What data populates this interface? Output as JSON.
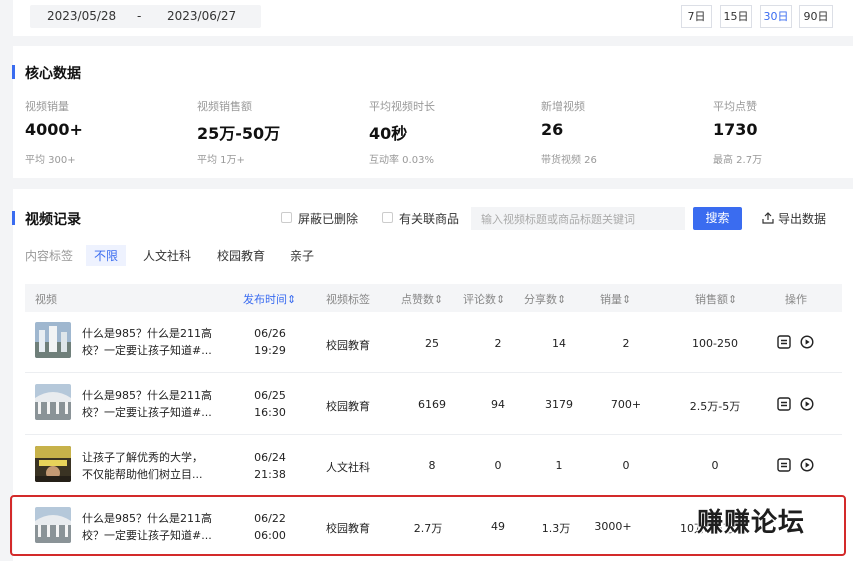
{
  "date_range": {
    "start": "2023/05/28",
    "sep": "-",
    "end": "2023/06/27"
  },
  "range_buttons": [
    "7日",
    "15日",
    "30日",
    "90日"
  ],
  "range_active": "30日",
  "core": {
    "title": "核心数据",
    "metrics": [
      {
        "label": "视频销量",
        "value": "4000+",
        "sub": "平均 300+"
      },
      {
        "label": "视频销售额",
        "value": "25万-50万",
        "sub": "平均 1万+"
      },
      {
        "label": "平均视频时长",
        "value": "40秒",
        "sub": "互动率 0.03%"
      },
      {
        "label": "新增视频",
        "value": "26",
        "sub": "带货视频 26"
      },
      {
        "label": "平均点赞",
        "value": "1730",
        "sub": "最高 2.7万"
      }
    ]
  },
  "records": {
    "title": "视频记录",
    "filter_deleted": "屏蔽已删除",
    "filter_goods": "有关联商品",
    "search_placeholder": "输入视频标题或商品标题关键词",
    "search_label": "搜索",
    "export_label": "导出数据",
    "tag_label": "内容标签",
    "tags": [
      "不限",
      "人文社科",
      "校园教育",
      "亲子"
    ],
    "columns": [
      "视频",
      "发布时间",
      "视频标签",
      "点赞数",
      "评论数",
      "分享数",
      "销量",
      "销售额",
      "操作"
    ],
    "rows": [
      {
        "title1": "什么是985？什么是211高",
        "title2": "校？一定要让孩子知道#...",
        "date": "06/26",
        "time": "19:29",
        "tag": "校园教育",
        "likes": "25",
        "comments": "2",
        "shares": "14",
        "sales": "2",
        "revenue": "100-250"
      },
      {
        "title1": "什么是985？什么是211高",
        "title2": "校？一定要让孩子知道#...",
        "date": "06/25",
        "time": "16:30",
        "tag": "校园教育",
        "likes": "6169",
        "comments": "94",
        "shares": "3179",
        "sales": "700+",
        "revenue": "2.5万-5万"
      },
      {
        "title1": "让孩子了解优秀的大学，",
        "title2": "不仅能帮助他们树立目...",
        "date": "06/24",
        "time": "21:38",
        "tag": "人文社科",
        "likes": "8",
        "comments": "0",
        "shares": "1",
        "sales": "0",
        "revenue": "0"
      },
      {
        "title1": "什么是985？什么是211高",
        "title2": "校？一定要让孩子知道#...",
        "date": "06/22",
        "time": "06:00",
        "tag": "校园教育",
        "likes": "2.7万",
        "comments": "49",
        "shares": "1.3万",
        "sales": "3000+",
        "revenue": "10万-25万"
      }
    ]
  },
  "watermark": "赚赚论坛",
  "colors": {
    "accent": "#3a6cf0",
    "highlight_border": "#d32a2a"
  }
}
